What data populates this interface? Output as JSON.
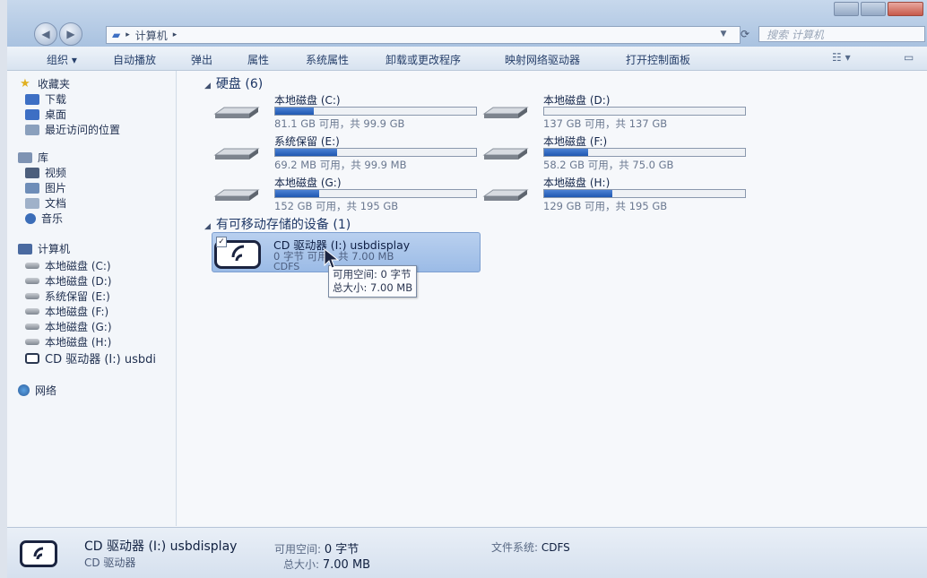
{
  "address": {
    "crumb": "计算机"
  },
  "search": {
    "placeholder": "搜索 计算机"
  },
  "toolbar": {
    "organize": "组织 ▾",
    "autoplay": "自动播放",
    "eject": "弹出",
    "properties": "属性",
    "system_properties": "系统属性",
    "uninstall": "卸载或更改程序",
    "map_drive": "映射网络驱动器",
    "control_panel": "打开控制面板"
  },
  "nav": {
    "favorites": "收藏夹",
    "downloads": "下载",
    "desktop": "桌面",
    "recent": "最近访问的位置",
    "libraries": "库",
    "videos": "视频",
    "pictures": "图片",
    "documents": "文档",
    "music": "音乐",
    "computer": "计算机",
    "drives": [
      "本地磁盘 (C:)",
      "本地磁盘 (D:)",
      "系统保留 (E:)",
      "本地磁盘 (F:)",
      "本地磁盘 (G:)",
      "本地磁盘 (H:)"
    ],
    "cd": "CD 驱动器 (I:) usbdi",
    "network": "网络"
  },
  "groups": {
    "hard_disks": "硬盘 (6)",
    "removable": "有可移动存储的设备 (1)"
  },
  "drives": [
    {
      "name": "本地磁盘 (C:)",
      "info": "81.1 GB 可用，共 99.9 GB",
      "used_fraction": 0.19
    },
    {
      "name": "本地磁盘 (D:)",
      "info": "137 GB 可用，共 137 GB",
      "used_fraction": 0.0
    },
    {
      "name": "系统保留 (E:)",
      "info": "69.2 MB 可用，共 99.9 MB",
      "used_fraction": 0.31
    },
    {
      "name": "本地磁盘 (F:)",
      "info": "58.2 GB 可用，共 75.0 GB",
      "used_fraction": 0.22
    },
    {
      "name": "本地磁盘 (G:)",
      "info": "152 GB 可用，共 195 GB",
      "used_fraction": 0.22
    },
    {
      "name": "本地磁盘 (H:)",
      "info": "129 GB 可用，共 195 GB",
      "used_fraction": 0.34
    }
  ],
  "cd": {
    "name": "CD 驱动器 (I:) usbdisplay",
    "space": "0 字节 可用，共 7.00 MB",
    "fs": "CDFS",
    "tooltip_free": "可用空间: 0 字节",
    "tooltip_total": "总大小: 7.00 MB"
  },
  "details": {
    "name": "CD 驱动器 (I:) usbdisplay",
    "type": "CD 驱动器",
    "free_label": "可用空间:",
    "free_value": "0 字节",
    "total_label": "总大小:",
    "total_value": "7.00 MB",
    "fs_label": "文件系统:",
    "fs_value": "CDFS"
  },
  "colors": {
    "accent": "#1f58b2",
    "selection": "#a9c6ec"
  }
}
